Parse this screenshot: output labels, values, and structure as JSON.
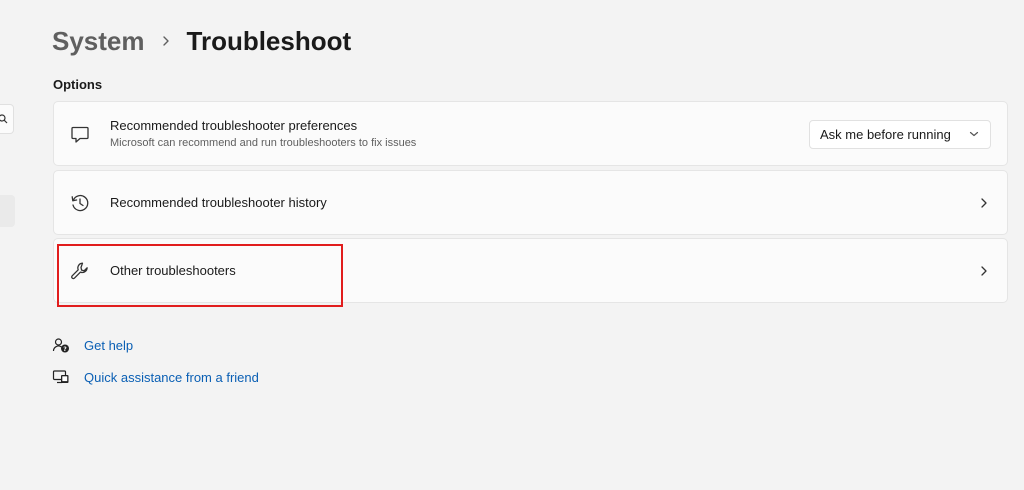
{
  "breadcrumb": {
    "parent": "System",
    "current": "Troubleshoot"
  },
  "section": {
    "label": "Options"
  },
  "options": [
    {
      "icon": "chat-bubble-icon",
      "title": "Recommended troubleshooter preferences",
      "subtitle": "Microsoft can recommend and run troubleshooters to fix issues",
      "control": "dropdown",
      "value": "Ask me before running"
    },
    {
      "icon": "history-icon",
      "title": "Recommended troubleshooter history",
      "control": "chevron"
    },
    {
      "icon": "wrench-icon",
      "title": "Other troubleshooters",
      "control": "chevron"
    }
  ],
  "links": [
    {
      "icon": "get-help-icon",
      "label": "Get help"
    },
    {
      "icon": "quick-assist-icon",
      "label": "Quick assistance from a friend"
    }
  ],
  "colors": {
    "background": "#f3f3f3",
    "card": "#fbfbfb",
    "link": "#0a5fb4",
    "highlight": "#e11d1d"
  }
}
